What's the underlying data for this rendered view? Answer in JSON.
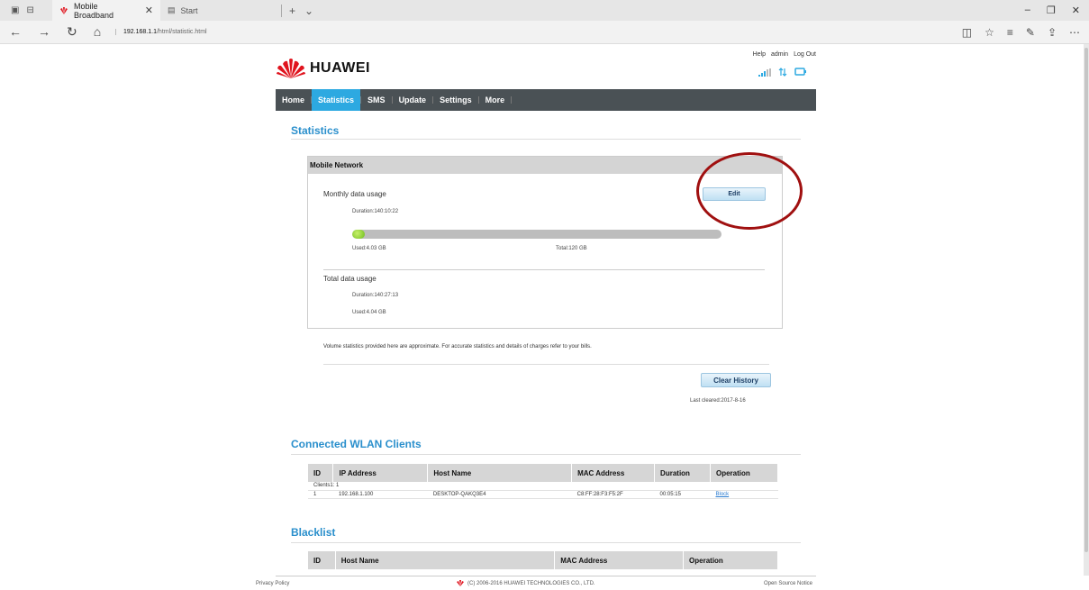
{
  "browser": {
    "tabs": [
      {
        "label": "Mobile Broadband",
        "active": true
      },
      {
        "label": "Start",
        "active": false
      }
    ],
    "url_host": "192.168.1.1",
    "url_path": "/html/statistic.html"
  },
  "header": {
    "links": [
      "Help",
      "admin",
      "Log Out"
    ],
    "brand": "HUAWEI"
  },
  "nav": [
    "Home",
    "Statistics",
    "SMS",
    "Update",
    "Settings",
    "More"
  ],
  "page_title": "Statistics",
  "mobile_network": {
    "title": "Mobile Network",
    "monthly_label": "Monthly data usage",
    "edit_label": "Edit",
    "monthly_duration": "Duration:140:10:22",
    "monthly_used": "Used:4.03 GB",
    "monthly_total": "Total:120 GB",
    "monthly_progress_fraction": 0.0336,
    "total_label": "Total data usage",
    "total_duration": "Duration:140:27:13",
    "total_used": "Used:4.04 GB"
  },
  "note": "Volume statistics provided here are approximate. For accurate statistics and details of charges refer to your bills.",
  "clear_history_label": "Clear History",
  "last_cleared": "Last cleared:2017-8-16",
  "wlan": {
    "title": "Connected WLAN Clients",
    "headers": [
      "ID",
      "IP Address",
      "Host Name",
      "MAC Address",
      "Duration",
      "Operation"
    ],
    "clients_count": "Clients1: 1",
    "rows": [
      {
        "id": "1",
        "ip": "192.168.1.100",
        "host": "DESKTOP-QAKQ3E4",
        "mac": "C8:FF:28:F3:F5:2F",
        "duration": "00:05:15",
        "op": "Block"
      }
    ]
  },
  "blacklist": {
    "title": "Blacklist",
    "headers": [
      "ID",
      "Host Name",
      "MAC Address",
      "Operation"
    ]
  },
  "footer": {
    "privacy": "Privacy Policy",
    "copyright": "(C) 2006-2016 HUAWEI TECHNOLOGIES CO., LTD.",
    "open_source": "Open Source Notice"
  },
  "colors": {
    "accent": "#2da9e1",
    "nav_bg": "#4a5155",
    "title_blue": "#2a8fcc",
    "annotation": "#a01010"
  }
}
